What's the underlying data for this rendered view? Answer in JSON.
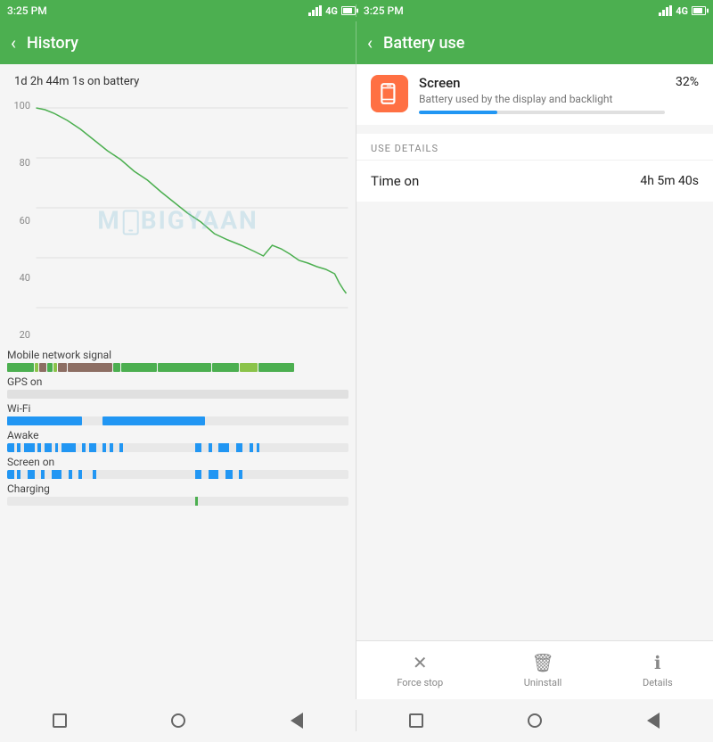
{
  "left_status": {
    "time": "3:25 PM",
    "network": "4G"
  },
  "right_status": {
    "time": "3:25 PM",
    "network": "4G"
  },
  "left_header": {
    "back_label": "‹",
    "title": "History"
  },
  "right_header": {
    "back_label": "‹",
    "title": "Battery use"
  },
  "battery_time": "1d 2h 44m 1s on battery",
  "chart": {
    "y_labels": [
      "100",
      "80",
      "60",
      "40",
      "20"
    ]
  },
  "watermark": {
    "text_before": "M",
    "text_after": "BIGYAAN"
  },
  "usage": {
    "network_label": "Mobile network signal",
    "gps_label": "GPS on",
    "wifi_label": "Wi-Fi",
    "awake_label": "Awake",
    "screen_on_label": "Screen on",
    "charging_label": "Charging"
  },
  "screen_item": {
    "name": "Screen",
    "description": "Battery used by the display and backlight",
    "percent": "32%",
    "progress_width": "32"
  },
  "use_details": {
    "header": "USE DETAILS",
    "rows": [
      {
        "label": "Time on",
        "value": "4h 5m 40s"
      }
    ]
  },
  "action_buttons": [
    {
      "icon": "×",
      "label": "Force stop"
    },
    {
      "icon": "🗑",
      "label": "Uninstall"
    },
    {
      "icon": "ℹ",
      "label": "Details"
    }
  ],
  "nav": {
    "square": "□",
    "circle": "○",
    "triangle": "◁"
  }
}
